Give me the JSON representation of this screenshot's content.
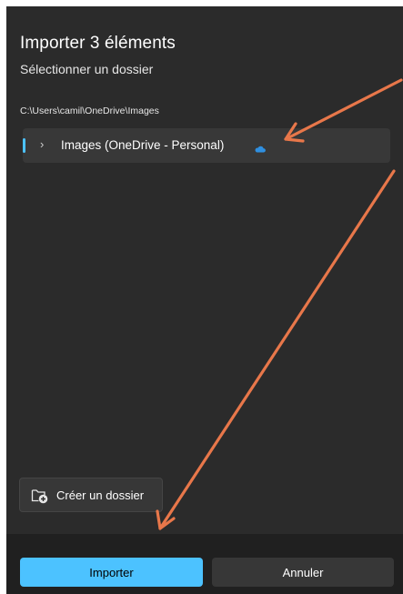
{
  "dialog": {
    "title": "Importer 3 éléments",
    "subtitle": "Sélectionner un dossier",
    "path": "C:\\Users\\camil\\OneDrive\\Images"
  },
  "folder_tree": {
    "items": [
      {
        "label": "Images (OneDrive - Personal)",
        "icon": "cloud-icon",
        "expanded": false,
        "selected": true
      }
    ]
  },
  "actions": {
    "new_folder_label": "Créer un dossier",
    "import_label": "Importer",
    "cancel_label": "Annuler"
  },
  "colors": {
    "dialog_bg": "#2b2b2b",
    "footer_bg": "#202020",
    "accent": "#4cc2ff",
    "annotation_arrow": "#e8774a"
  }
}
